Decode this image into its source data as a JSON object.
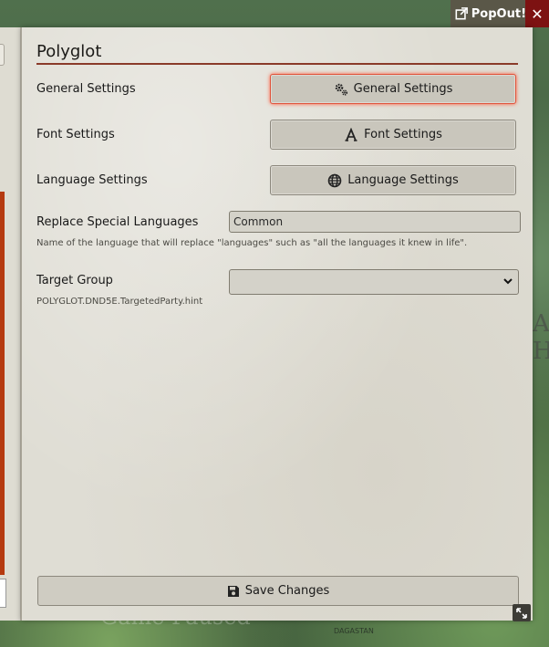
{
  "background": {
    "watermark_text": "Game Paused",
    "place_label": "DAGASTAN",
    "side_letters": "A\nH"
  },
  "popout": {
    "label": "PopOut!",
    "close_label": "✕"
  },
  "window": {
    "title": "Polyglot",
    "rows": {
      "general_label": "General Settings",
      "general_button": "General Settings",
      "font_label": "Font Settings",
      "font_button": "Font Settings",
      "language_label": "Language Settings",
      "language_button": "Language Settings",
      "replace_label": "Replace Special Languages",
      "replace_value": "Common",
      "replace_hint": "Name of the language that will replace \"languages\" such as \"all the languages it knew in life\".",
      "target_label": "Target Group",
      "target_value": "",
      "target_hint": "POLYGLOT.DND5E.TargetedParty.hint"
    },
    "save_label": "Save Changes"
  },
  "icons": {
    "general": "cogs-icon",
    "font": "font-icon",
    "language": "globe-icon",
    "save": "floppy-disk-icon",
    "popout": "external-link-icon",
    "resize": "expand-icon"
  }
}
